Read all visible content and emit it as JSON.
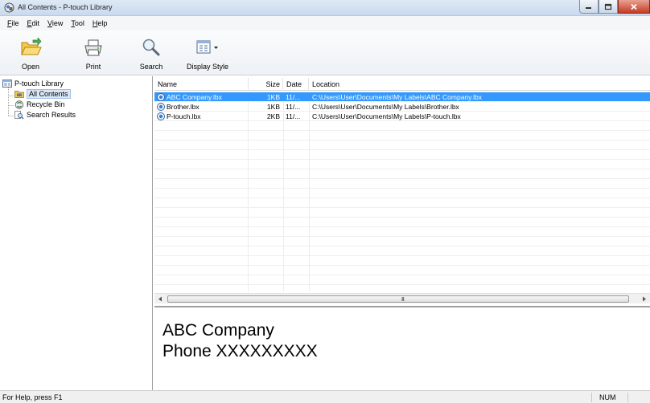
{
  "window": {
    "title": "All Contents - P-touch Library"
  },
  "menu": [
    {
      "accel": "F",
      "rest": "ile"
    },
    {
      "accel": "E",
      "rest": "dit"
    },
    {
      "accel": "V",
      "rest": "iew"
    },
    {
      "accel": "T",
      "rest": "ool"
    },
    {
      "accel": "H",
      "rest": "elp"
    }
  ],
  "toolbar": {
    "open_label": "Open",
    "print_label": "Print",
    "search_label": "Search",
    "display_style_label": "Display Style"
  },
  "tree": {
    "root": "P-touch Library",
    "items": [
      "All Contents",
      "Recycle Bin",
      "Search Results"
    ],
    "selected": "All Contents"
  },
  "list": {
    "columns": [
      "Name",
      "Size",
      "Date",
      "Location"
    ],
    "rows": [
      {
        "name": "ABC Company.lbx",
        "size": "1KB",
        "date": "11/...",
        "location": "C:\\Users\\User\\Documents\\My Labels\\ABC Company.lbx",
        "selected": true
      },
      {
        "name": "Brother.lbx",
        "size": "1KB",
        "date": "11/...",
        "location": "C:\\Users\\User\\Documents\\My Labels\\Brother.lbx",
        "selected": false
      },
      {
        "name": "P-touch.lbx",
        "size": "2KB",
        "date": "11/...",
        "location": "C:\\Users\\User\\Documents\\My Labels\\P-touch.lbx",
        "selected": false
      }
    ],
    "scroll_grip": "III"
  },
  "preview": {
    "line1": "ABC Company",
    "line2": "Phone XXXXXXXXX"
  },
  "status": {
    "help": "For Help, press F1",
    "num": "NUM"
  },
  "colors": {
    "selection": "#3399ff",
    "close_button": "#c43b25"
  }
}
